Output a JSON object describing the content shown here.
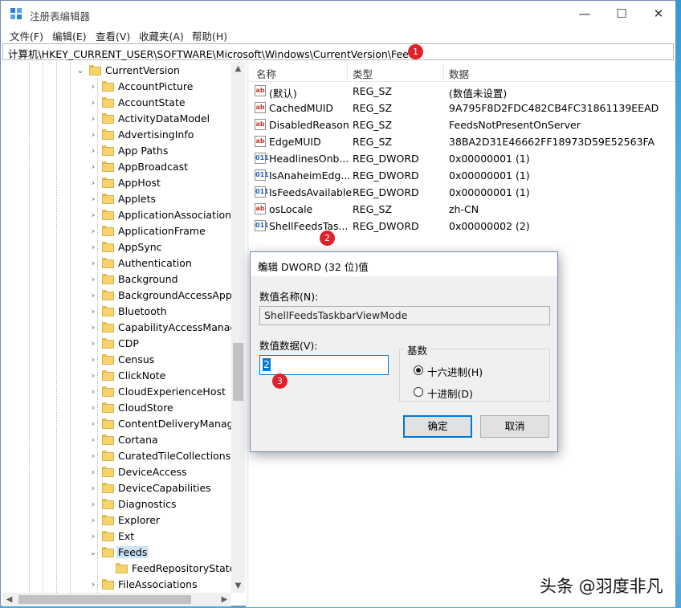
{
  "window": {
    "title": "注册表编辑器",
    "minimize": "—",
    "maximize": "☐",
    "close": "✕"
  },
  "menu": [
    "文件(F)",
    "编辑(E)",
    "查看(V)",
    "收藏夹(A)",
    "帮助(H)"
  ],
  "address": {
    "path": "计算机\\HKEY_CURRENT_USER\\SOFTWARE\\Microsoft\\Windows\\CurrentVersion\\Feeds",
    "badge": "1"
  },
  "tree": {
    "root": "CurrentVersion",
    "items": [
      "AccountPicture",
      "AccountState",
      "ActivityDataModel",
      "AdvertisingInfo",
      "App Paths",
      "AppBroadcast",
      "AppHost",
      "Applets",
      "ApplicationAssociationTo",
      "ApplicationFrame",
      "AppSync",
      "Authentication",
      "Background",
      "BackgroundAccessApplic",
      "Bluetooth",
      "CapabilityAccessManage",
      "CDP",
      "Census",
      "ClickNote",
      "CloudExperienceHost",
      "CloudStore",
      "ContentDeliveryManager",
      "Cortana",
      "CuratedTileCollections",
      "DeviceAccess",
      "DeviceCapabilities",
      "Diagnostics",
      "Explorer",
      "Ext",
      "Feeds",
      "FeedRepositoryState",
      "FileAssociations"
    ]
  },
  "list": {
    "headers": {
      "name": "名称",
      "type": "类型",
      "data": "数据"
    },
    "rows": [
      {
        "icon": "ab",
        "name": "(默认)",
        "type": "REG_SZ",
        "data": "(数值未设置)"
      },
      {
        "icon": "ab",
        "name": "CachedMUID",
        "type": "REG_SZ",
        "data": "9A795F8D2FDC482CB4FC31861139EEAD"
      },
      {
        "icon": "ab",
        "name": "DisabledReason",
        "type": "REG_SZ",
        "data": "FeedsNotPresentOnServer"
      },
      {
        "icon": "ab",
        "name": "EdgeMUID",
        "type": "REG_SZ",
        "data": "38BA2D31E46662FF18973D59E52563FA"
      },
      {
        "icon": "011",
        "name": "HeadlinesOnb...",
        "type": "REG_DWORD",
        "data": "0x00000001 (1)"
      },
      {
        "icon": "011",
        "name": "IsAnaheimEdg...",
        "type": "REG_DWORD",
        "data": "0x00000001 (1)"
      },
      {
        "icon": "011",
        "name": "IsFeedsAvailable",
        "type": "REG_DWORD",
        "data": "0x00000001 (1)"
      },
      {
        "icon": "ab",
        "name": "osLocale",
        "type": "REG_SZ",
        "data": "zh-CN"
      },
      {
        "icon": "011",
        "name": "ShellFeedsTas...",
        "type": "REG_DWORD",
        "data": "0x00000002 (2)"
      }
    ],
    "badge": "2"
  },
  "dialog": {
    "title": "编辑 DWORD (32 位)值",
    "name_label": "数值名称(N):",
    "name_value": "ShellFeedsTaskbarViewMode",
    "value_label": "数值数据(V):",
    "value": "2",
    "value_badge": "3",
    "base_label": "基数",
    "hex_label": "十六进制(H)",
    "dec_label": "十进制(D)",
    "selected_base": "hex",
    "ok": "确定",
    "cancel": "取消"
  },
  "watermark": "头条 @羽度非凡",
  "colors": {
    "badge": "#e0212b",
    "accent": "#0078d7",
    "folder": "#f7d46b"
  }
}
